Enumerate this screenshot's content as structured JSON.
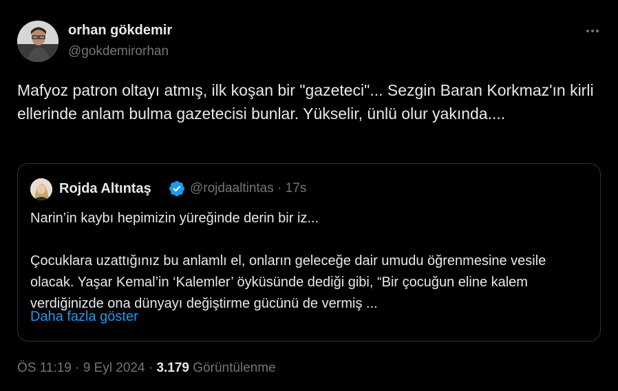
{
  "author": {
    "name": "orhan gökdemir",
    "handle": "@gokdemirorhan"
  },
  "tweet": {
    "text": "Mafyoz patron oltayı atmış, ilk koşan bir \"gazeteci\"... Sezgin Baran Korkmaz'ın kirli ellerinde anlam bulma gazetecisi bunlar. Yükselir, ünlü olur yakında...."
  },
  "quote": {
    "name": "Rojda Altıntaş",
    "handle": "@rojdaaltintas",
    "separator": "·",
    "time": "17s",
    "text": "Narin’in kaybı hepimizin yüreğinde derin bir iz...\n\nÇocuklara uzattığınız bu anlamlı el, onların geleceğe dair umudu öğrenmesine vesile olacak. Yaşar Kemal’in ‘Kalemler’ öyküsünde dediği gibi, “Bir çocuğun eline kalem verdiğinizde ona dünyayı değiştirme gücünü de vermiş ...",
    "show_more": "Daha fazla göster"
  },
  "footer": {
    "time": "ÖS 11:19",
    "sep1": "·",
    "date": "9 Eyl 2024",
    "sep2": "·",
    "views_count": "3.179",
    "views_label": "Görüntülenme"
  },
  "colors": {
    "background": "#000000",
    "text": "#e7e9ea",
    "muted": "#71767b",
    "link": "#1d9bf0",
    "border": "#2f3336",
    "verified": "#1d9bf0"
  },
  "icons": {
    "more": "more-horizontal-icon",
    "verified": "verified-badge-icon"
  }
}
